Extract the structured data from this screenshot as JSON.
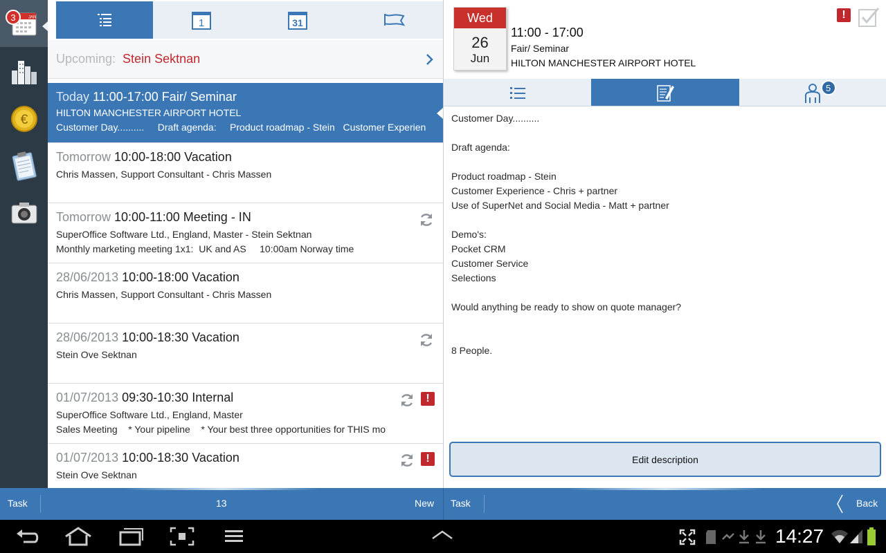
{
  "rail": {
    "calendar_badge": "3",
    "calendar_month": "JAN"
  },
  "list": {
    "tabs": [
      "list",
      "day",
      "month",
      "flag"
    ],
    "day_tab_number": "1",
    "month_tab_number": "31",
    "upcoming_label": "Upcoming:",
    "upcoming_value": "Stein Sektnan",
    "items": [
      {
        "when": "Today",
        "title": "11:00-17:00 Fair/ Seminar",
        "line1": "HILTON MANCHESTER AIRPORT HOTEL",
        "line2": "Customer Day..........     Draft agenda:     Product roadmap - Stein   Customer Experien"
      },
      {
        "when": "Tomorrow",
        "title": "10:00-18:00 Vacation",
        "line1": "Chris Massen, Support Consultant - Chris Massen",
        "line2": ""
      },
      {
        "when": "Tomorrow",
        "title": "10:00-11:00 Meeting - IN",
        "line1": "SuperOffice Software Ltd., England, Master - Stein Sektnan",
        "line2": "Monthly marketing meeting 1x1:  UK and AS     10:00am Norway time"
      },
      {
        "when": "28/06/2013",
        "title": "10:00-18:00 Vacation",
        "line1": "Chris Massen, Support Consultant - Chris Massen",
        "line2": ""
      },
      {
        "when": "28/06/2013",
        "title": "10:00-18:30 Vacation",
        "line1": "Stein Ove Sektnan",
        "line2": ""
      },
      {
        "when": "01/07/2013",
        "title": "09:30-10:30 Internal",
        "line1": "SuperOffice Software Ltd., England, Master",
        "line2": "Sales Meeting    * Your pipeline    * Your best three opportunities for THIS mo"
      },
      {
        "when": "01/07/2013",
        "title": "10:00-18:30 Vacation",
        "line1": "Stein Ove Sektnan",
        "line2": ""
      }
    ]
  },
  "detail": {
    "weekday": "Wed",
    "day": "26",
    "month": "Jun",
    "time": "11:00 - 17:00",
    "type": "Fair/ Seminar",
    "location": "HILTON MANCHESTER AIRPORT HOTEL",
    "participants_count": "5",
    "description_lines": [
      "Customer Day..........",
      "",
      "Draft agenda:",
      "",
      "Product roadmap - Stein",
      "Customer Experience - Chris + partner",
      "Use of SuperNet and Social Media - Matt + partner",
      "",
      "Demo's:",
      "Pocket CRM",
      "Customer Service",
      "Selections",
      "",
      "Would anything be ready to show on quote manager?",
      "",
      "",
      "8 People."
    ],
    "edit_button": "Edit description"
  },
  "left_bar": {
    "task": "Task",
    "count": "13",
    "new": "New"
  },
  "right_bar": {
    "task": "Task",
    "back": "Back"
  },
  "status": {
    "clock": "14:27"
  },
  "colors": {
    "accent": "#3a77b4",
    "alert": "#c0282e",
    "rail": "#2c3a45"
  }
}
